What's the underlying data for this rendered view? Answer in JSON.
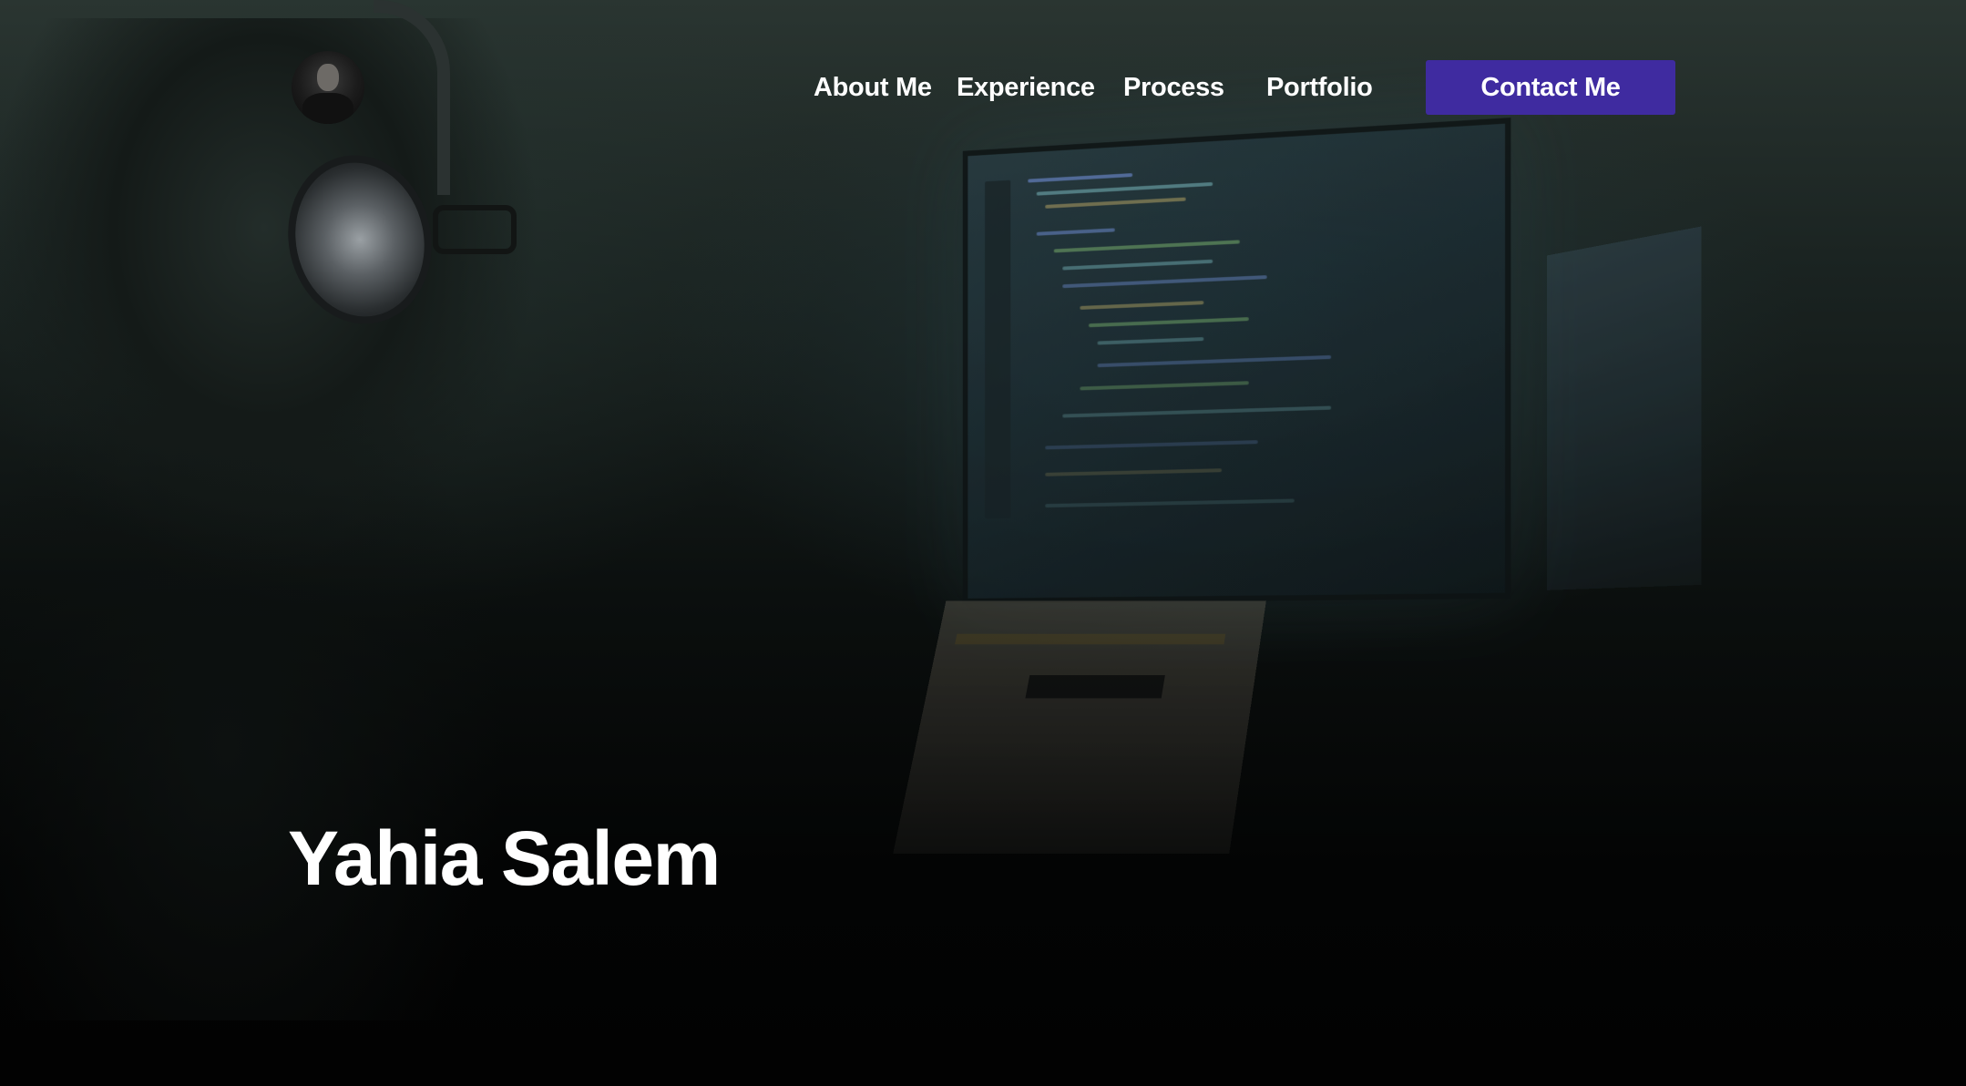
{
  "nav": {
    "links": [
      {
        "label": "About Me"
      },
      {
        "label": "Experience"
      },
      {
        "label": "Process"
      },
      {
        "label": "Portfolio"
      }
    ],
    "contact_label": "Contact Me"
  },
  "hero": {
    "name": "Yahia Salem"
  },
  "colors": {
    "accent": "#3f2ba0",
    "text": "#ffffff",
    "background": "#050606"
  }
}
